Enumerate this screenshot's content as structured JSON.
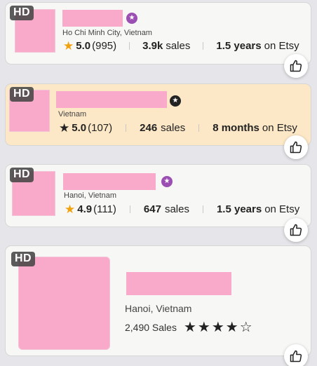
{
  "hd_label": "HD",
  "cards": [
    {
      "location": "Ho Chi Minh City, Vietnam",
      "rating": "5.0",
      "reviews": "(995)",
      "sales_value": "3.9k",
      "sales_suffix": "sales",
      "years_value": "1.5 years",
      "years_suffix": "on Etsy",
      "badge_color": "#9b4fb2"
    },
    {
      "location": "Vietnam",
      "rating": "5.0",
      "reviews": "(107)",
      "sales_value": "246",
      "sales_suffix": "sales",
      "years_value": "8 months",
      "years_suffix": "on Etsy",
      "badge_color": "#222222"
    },
    {
      "location": "Hanoi, Vietnam",
      "rating": "4.9",
      "reviews": "(111)",
      "sales_value": "647",
      "sales_suffix": "sales",
      "years_value": "1.5 years",
      "years_suffix": "on Etsy",
      "badge_color": "#9b4fb2"
    },
    {
      "location": "Hanoi, Vietnam",
      "sales_text": "2,490 Sales",
      "rating_stars": 4.5
    }
  ],
  "colors": {
    "redaction": "#f9a9c9",
    "highlight_bg": "#fce8c6",
    "star_gold": "#f1a10d"
  }
}
